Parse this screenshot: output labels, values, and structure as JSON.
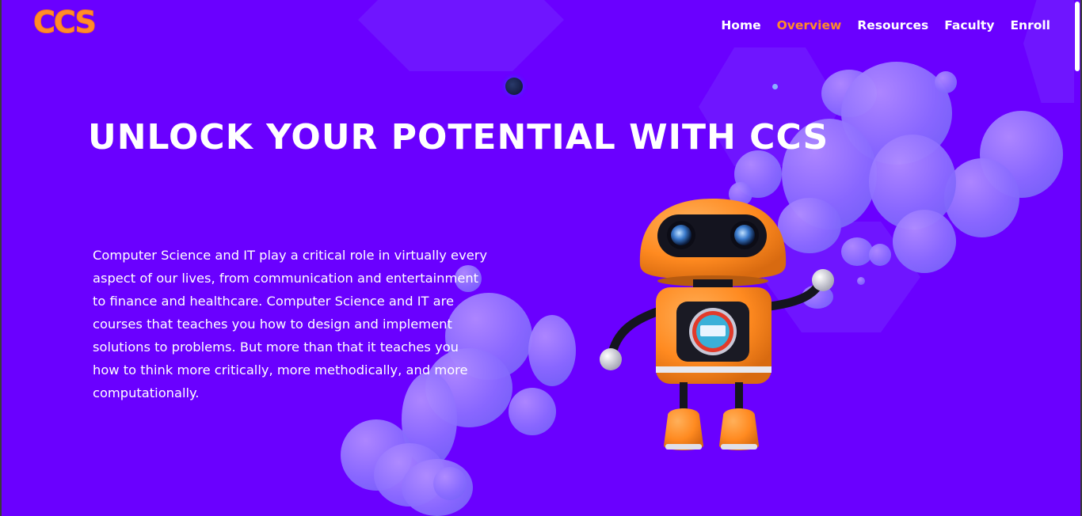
{
  "brand": {
    "logo_text": "CCS"
  },
  "nav": {
    "items": [
      {
        "label": "Home",
        "active": false
      },
      {
        "label": "Overview",
        "active": true
      },
      {
        "label": "Resources",
        "active": false
      },
      {
        "label": "Faculty",
        "active": false
      },
      {
        "label": "Enroll",
        "active": false
      }
    ]
  },
  "hero": {
    "headline": "UNLOCK YOUR POTENTIAL WITH CCS",
    "description": "Computer Science and IT play a critical role in virtually every aspect of our lives, from communication and entertainment to finance and healthcare. Computer Science and IT are courses that teaches you how to design and implement solutions to problems. But more than that it teaches you how to think more critically, more methodically, and more computationally."
  },
  "colors": {
    "background": "#6a00ff",
    "accent": "#ff8a2a",
    "text": "#ffffff",
    "blob": "#8a6cff"
  },
  "icons": {
    "robot": "robot-illustration"
  }
}
